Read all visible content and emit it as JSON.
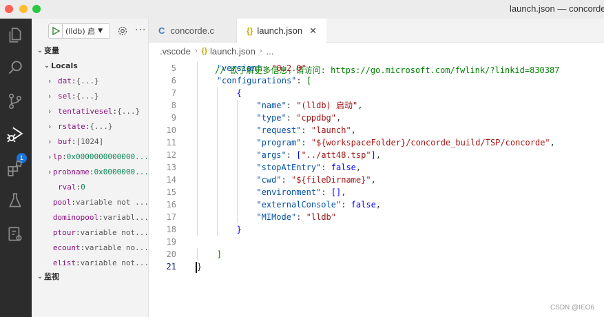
{
  "window": {
    "title": "launch.json — concorde"
  },
  "activity_bar": {
    "icons": [
      "explorer-icon",
      "search-icon",
      "source-control-icon",
      "run-debug-icon",
      "extensions-icon",
      "testing-icon",
      "remote-explorer-icon"
    ],
    "debug_badge": "1"
  },
  "sidebar": {
    "config_label": "(lldb) 启",
    "variables_header": "变量",
    "locals_header": "Locals",
    "watch_header": "监视",
    "variables": [
      {
        "name": "dat",
        "value": "{...}",
        "expandable": true
      },
      {
        "name": "sel",
        "value": "{...}",
        "expandable": true
      },
      {
        "name": "tentativesel",
        "value": "{...}",
        "expandable": true
      },
      {
        "name": "rstate",
        "value": "{...}",
        "expandable": true
      },
      {
        "name": "buf",
        "value": "[1024]",
        "expandable": true
      },
      {
        "name": "lp",
        "value": "0x0000000000000...",
        "expandable": true,
        "numeric": true
      },
      {
        "name": "probname",
        "value": "0x0000000...",
        "expandable": true,
        "numeric": true
      },
      {
        "name": "rval",
        "value": "0",
        "expandable": false,
        "numeric": true
      },
      {
        "name": "pool",
        "value": "variable not ...",
        "expandable": false
      },
      {
        "name": "dominopool",
        "value": "variabl...",
        "expandable": false
      },
      {
        "name": "ptour",
        "value": "variable not...",
        "expandable": false
      },
      {
        "name": "ecount",
        "value": "variable no...",
        "expandable": false
      },
      {
        "name": "elist",
        "value": "variable not...",
        "expandable": false
      }
    ]
  },
  "tabs": [
    {
      "label": "concorde.c",
      "icon": "c-file-icon",
      "active": false
    },
    {
      "label": "launch.json",
      "icon": "json-file-icon",
      "active": true
    }
  ],
  "breadcrumb": [
    ".vscode",
    "launch.json",
    "..."
  ],
  "code": {
    "top_partial": "// 欲了解更多信息，请访问: https://go.microsoft.com/fwlink/?linkid=830387",
    "lines": [
      {
        "n": "5",
        "indent": 1,
        "tokens": [
          [
            "k",
            "\"version\""
          ],
          [
            "p",
            ": "
          ],
          [
            "s",
            "\"0.2.0\""
          ],
          [
            "p",
            ","
          ]
        ]
      },
      {
        "n": "6",
        "indent": 1,
        "tokens": [
          [
            "k",
            "\"configurations\""
          ],
          [
            "p",
            ": "
          ],
          [
            "cm",
            "["
          ]
        ]
      },
      {
        "n": "7",
        "indent": 2,
        "tokens": [
          [
            "b",
            "{"
          ]
        ]
      },
      {
        "n": "8",
        "indent": 3,
        "tokens": [
          [
            "k",
            "\"name\""
          ],
          [
            "p",
            ": "
          ],
          [
            "s",
            "\"(lldb) 启动\""
          ],
          [
            "p",
            ","
          ]
        ]
      },
      {
        "n": "9",
        "indent": 3,
        "tokens": [
          [
            "k",
            "\"type\""
          ],
          [
            "p",
            ": "
          ],
          [
            "s",
            "\"cppdbg\""
          ],
          [
            "p",
            ","
          ]
        ]
      },
      {
        "n": "10",
        "indent": 3,
        "tokens": [
          [
            "k",
            "\"request\""
          ],
          [
            "p",
            ": "
          ],
          [
            "s",
            "\"launch\""
          ],
          [
            "p",
            ","
          ]
        ]
      },
      {
        "n": "11",
        "indent": 3,
        "tokens": [
          [
            "k",
            "\"program\""
          ],
          [
            "p",
            ": "
          ],
          [
            "s",
            "\"${workspaceFolder}/concorde_build/TSP/concorde\""
          ],
          [
            "p",
            ","
          ]
        ]
      },
      {
        "n": "12",
        "indent": 3,
        "tokens": [
          [
            "k",
            "\"args\""
          ],
          [
            "p",
            ": "
          ],
          [
            "b",
            "["
          ],
          [
            "s",
            "\"../att48.tsp\""
          ],
          [
            "b",
            "]"
          ],
          [
            "p",
            ","
          ]
        ]
      },
      {
        "n": "13",
        "indent": 3,
        "tokens": [
          [
            "k",
            "\"stopAtEntry\""
          ],
          [
            "p",
            ": "
          ],
          [
            "b",
            "false"
          ],
          [
            "p",
            ","
          ]
        ]
      },
      {
        "n": "14",
        "indent": 3,
        "tokens": [
          [
            "k",
            "\"cwd\""
          ],
          [
            "p",
            ": "
          ],
          [
            "s",
            "\"${fileDirname}\""
          ],
          [
            "p",
            ","
          ]
        ]
      },
      {
        "n": "15",
        "indent": 3,
        "tokens": [
          [
            "k",
            "\"environment\""
          ],
          [
            "p",
            ": "
          ],
          [
            "b",
            "[]"
          ],
          [
            "p",
            ","
          ]
        ]
      },
      {
        "n": "16",
        "indent": 3,
        "tokens": [
          [
            "k",
            "\"externalConsole\""
          ],
          [
            "p",
            ": "
          ],
          [
            "b",
            "false"
          ],
          [
            "p",
            ","
          ]
        ]
      },
      {
        "n": "17",
        "indent": 3,
        "tokens": [
          [
            "k",
            "\"MIMode\""
          ],
          [
            "p",
            ": "
          ],
          [
            "s",
            "\"lldb\""
          ]
        ]
      },
      {
        "n": "18",
        "indent": 2,
        "tokens": [
          [
            "b",
            "}"
          ]
        ]
      },
      {
        "n": "19",
        "indent": 0,
        "tokens": []
      },
      {
        "n": "20",
        "indent": 1,
        "tokens": [
          [
            "cm",
            "]"
          ]
        ]
      },
      {
        "n": "21",
        "indent": 0,
        "tokens": [
          [
            "p",
            "}"
          ]
        ],
        "active": true
      }
    ]
  },
  "watermark": "CSDN @IEO6"
}
